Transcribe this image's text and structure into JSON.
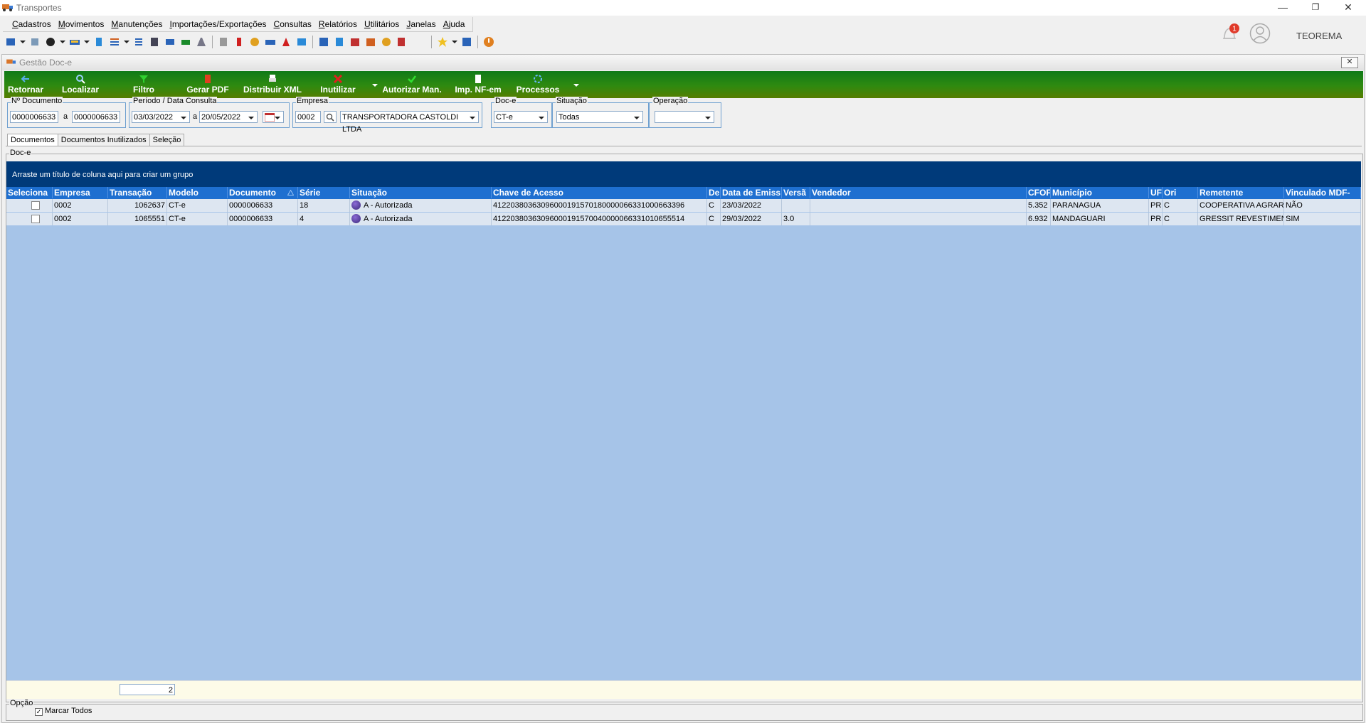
{
  "window": {
    "title": "Transportes",
    "minimize": "—",
    "restore": "❐",
    "close": "✕"
  },
  "menu": [
    "Cadastros",
    "Movimentos",
    "Manutenções",
    "Importações/Exportações",
    "Consultas",
    "Relatórios",
    "Utilitários",
    "Janelas",
    "Ajuda"
  ],
  "notifications": {
    "count": "1"
  },
  "user": {
    "name": "TEOREMA"
  },
  "subwindow": {
    "title": "Gestão Doc-e",
    "close": "✕"
  },
  "actions": {
    "retornar": "Retornar",
    "localizar": "Localizar",
    "filtro": "Filtro",
    "gerar_pdf": "Gerar PDF",
    "distribuir_xml": "Distribuir XML",
    "inutilizar": "Inutilizar",
    "autorizar_man": "Autorizar Man.",
    "imp_nfem": "Imp. NF-em",
    "processos": "Processos"
  },
  "filters": {
    "documento": {
      "label": "Nº Documento",
      "from": "0000006633",
      "sep": "a",
      "to": "0000006633"
    },
    "periodo": {
      "label": "Período / Data Consulta",
      "from": "03/03/2022",
      "sep": "a",
      "to": "20/05/2022"
    },
    "empresa": {
      "label": "Empresa",
      "code": "0002",
      "name": "TRANSPORTADORA CASTOLDI LTDA"
    },
    "doce": {
      "label": "Doc-e",
      "value": "CT-e"
    },
    "situacao": {
      "label": "Situação",
      "value": "Todas"
    },
    "operacao": {
      "label": "Operação",
      "value": ""
    }
  },
  "tabs": [
    "Documentos",
    "Documentos Inutilizados",
    "Seleção"
  ],
  "doc_group": {
    "label": "Doc-e",
    "group_hint": "Arraste um título de coluna aqui para criar um grupo"
  },
  "columns": [
    "Seleciona",
    "Empresa",
    "Transação",
    "Modelo",
    "Documento",
    "Série",
    "Situação",
    "Chave de Acesso",
    "De",
    "Data de Emiss",
    "Versã",
    "Vendedor",
    "CFOF",
    "Município",
    "UF",
    "Ori",
    "Remetente",
    "Vinculado MDF-"
  ],
  "rows": [
    {
      "empresa": "0002",
      "transacao": "1062637",
      "modelo": "CT-e",
      "documento": "0000006633",
      "serie": "18",
      "situacao": "A - Autorizada",
      "chave": "41220380363096000191570180000066331000663396",
      "de": "C",
      "data": "23/03/2022",
      "versao": "",
      "vendedor": "",
      "cfop": "5.352",
      "municipio": "PARANAGUA",
      "uf": "PR",
      "ori": "C",
      "remetente": "COOPERATIVA AGRAR",
      "vinculado": "NÃO"
    },
    {
      "empresa": "0002",
      "transacao": "1065551",
      "modelo": "CT-e",
      "documento": "0000006633",
      "serie": "4",
      "situacao": "A - Autorizada",
      "chave": "41220380363096000191570040000066331010655514",
      "de": "C",
      "data": "29/03/2022",
      "versao": "3.0",
      "vendedor": "",
      "cfop": "6.932",
      "municipio": "MANDAGUARI",
      "uf": "PR",
      "ori": "C",
      "remetente": "GRESSIT REVESTIMEN",
      "vinculado": "SIM"
    }
  ],
  "footer": {
    "count": "2"
  },
  "options": {
    "label": "Opção",
    "marcar_todos": "Marcar Todos"
  }
}
